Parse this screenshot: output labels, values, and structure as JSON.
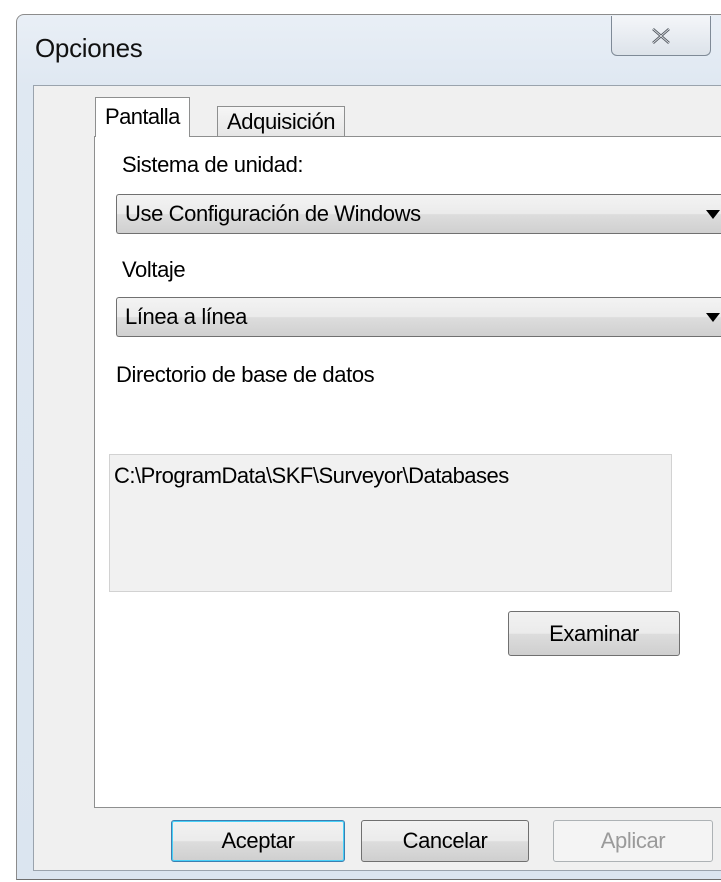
{
  "window": {
    "title": "Opciones",
    "close_icon": "close-icon"
  },
  "tabs": [
    {
      "label": "Pantalla",
      "selected": true
    },
    {
      "label": "Adquisición",
      "selected": false
    }
  ],
  "pantalla": {
    "unit_system": {
      "label": "Sistema de unidad:",
      "value": "Use Configuración de Windows",
      "icon": "chevron-down-icon"
    },
    "voltage": {
      "label": "Voltaje",
      "value": "Línea a línea",
      "icon": "chevron-down-icon"
    },
    "database_dir": {
      "label": "Directorio de base de datos",
      "value": "C:\\ProgramData\\SKF\\Surveyor\\Databases"
    },
    "browse_label": "Examinar"
  },
  "buttons": {
    "accept": "Aceptar",
    "cancel": "Cancelar",
    "apply": "Aplicar",
    "apply_enabled": false
  },
  "colors": {
    "frame": "#dfe8f2",
    "default_button_border": "#3c7fb1",
    "disabled_text": "#9a9a9a"
  }
}
